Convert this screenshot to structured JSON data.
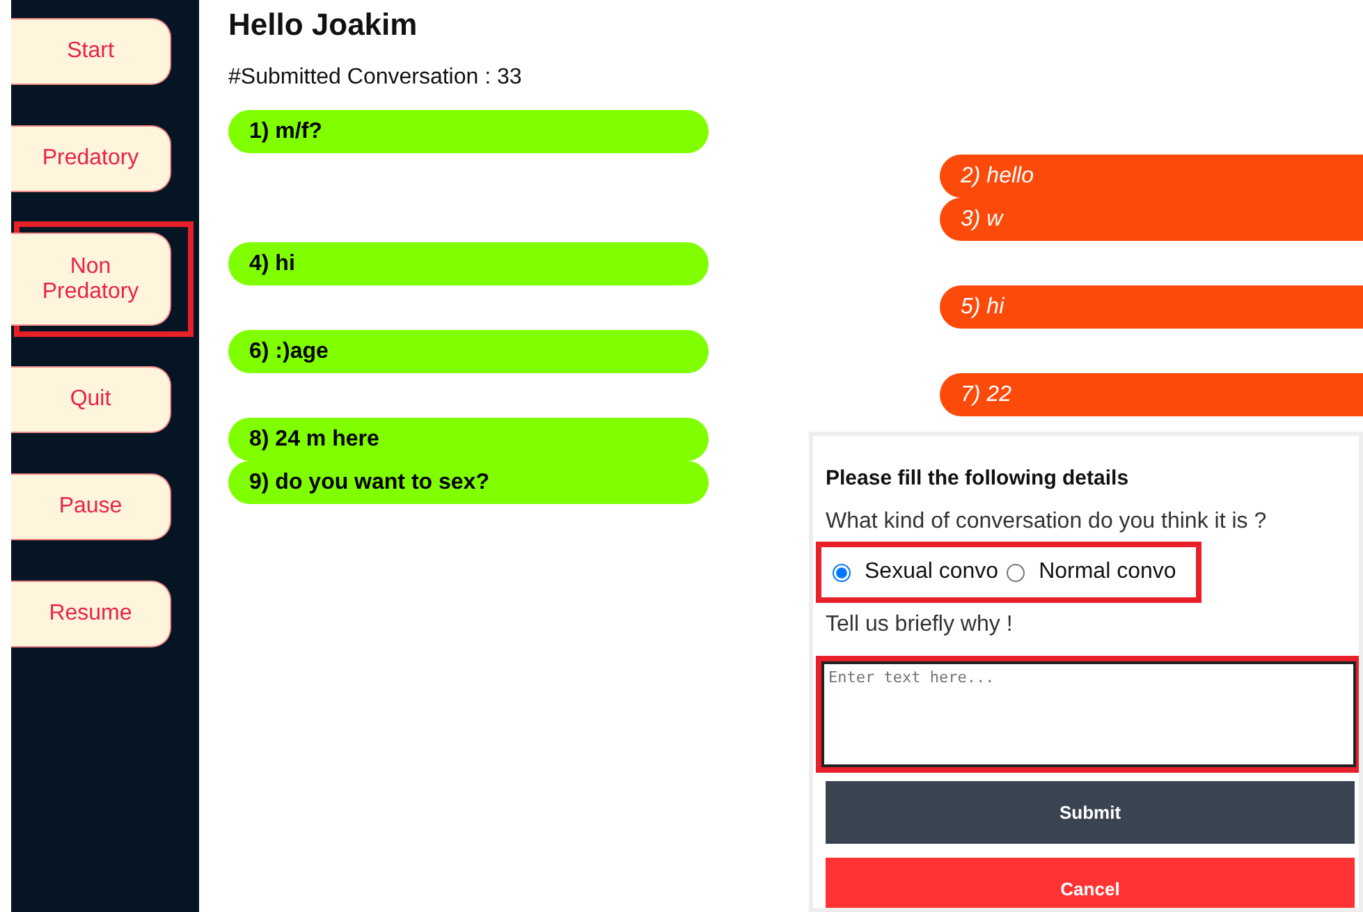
{
  "sidebar": {
    "buttons": [
      {
        "label": "Start",
        "highlighted": false
      },
      {
        "label": "Predatory",
        "highlighted": false
      },
      {
        "label": "Non Predatory",
        "highlighted": true
      },
      {
        "label": "Quit",
        "highlighted": false
      },
      {
        "label": "Pause",
        "highlighted": false
      },
      {
        "label": "Resume",
        "highlighted": false
      }
    ]
  },
  "greeting": "Hello Joakim",
  "submitted": "#Submitted Conversation : 33",
  "messages": [
    {
      "text": "1) m/f?",
      "kind": "incoming"
    },
    {
      "text": "2) hello",
      "kind": "outgoing"
    },
    {
      "text": "3) w",
      "kind": "outgoing"
    },
    {
      "text": "4) hi",
      "kind": "incoming"
    },
    {
      "text": "5) hi",
      "kind": "outgoing"
    },
    {
      "text": "6) :)age",
      "kind": "incoming"
    },
    {
      "text": "7) 22",
      "kind": "outgoing"
    },
    {
      "text": "8) 24 m here",
      "kind": "incoming"
    },
    {
      "text": "9) do you want to sex?",
      "kind": "incoming"
    }
  ],
  "form": {
    "title": "Please fill the following details",
    "question": "What kind of conversation do you think it is ?",
    "options_highlighted": true,
    "options": [
      {
        "label": "Sexual convo",
        "selected": true
      },
      {
        "label": "Normal convo",
        "selected": false
      }
    ],
    "why": "Tell us briefly why !",
    "reason": {
      "placeholder": "Enter text here...",
      "highlighted": true
    },
    "buttons": [
      {
        "label": "Submit",
        "kind": "submit"
      },
      {
        "label": "Cancel",
        "kind": "cancel"
      }
    ]
  }
}
